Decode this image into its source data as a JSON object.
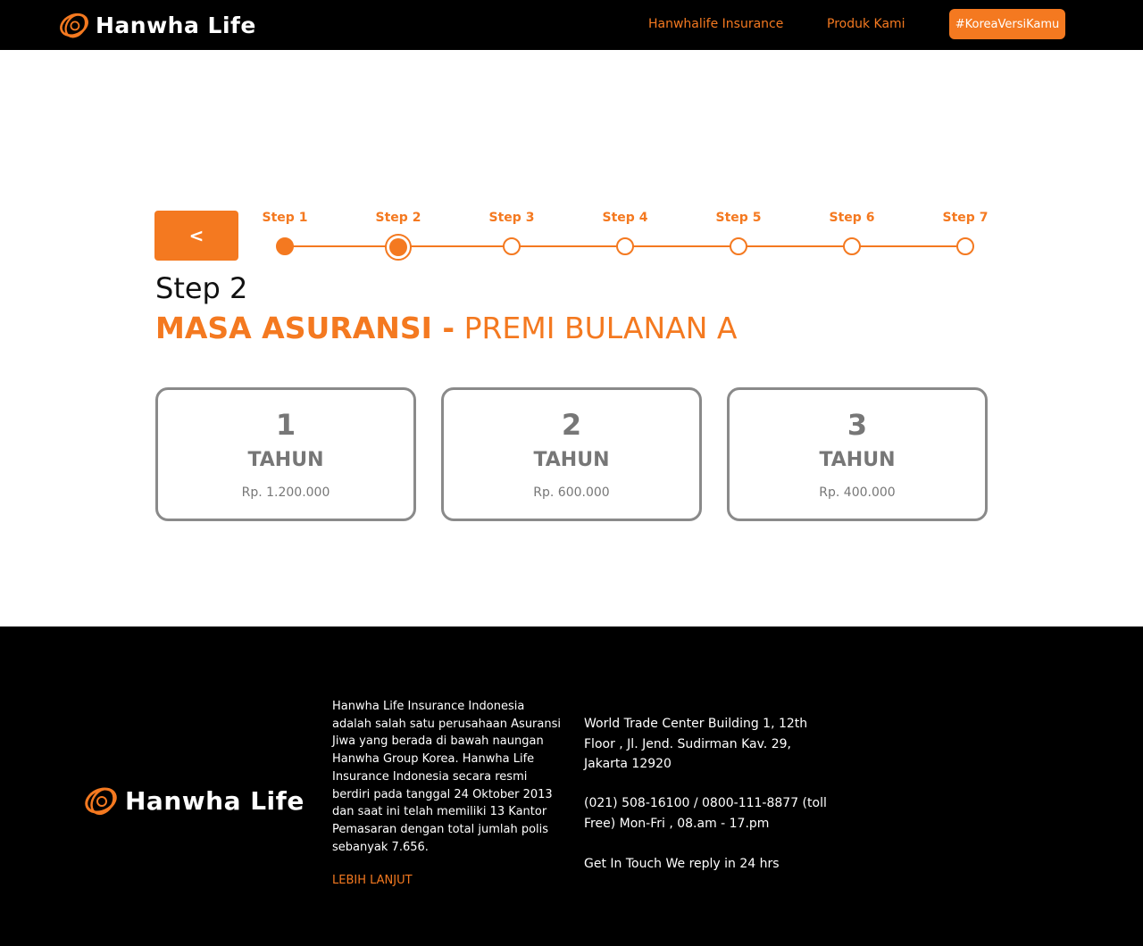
{
  "header": {
    "brand": "Hanwha Life",
    "nav": {
      "insurance": "Hanwhalife Insurance",
      "products": "Produk Kami",
      "cta": "#KoreaVersiKamu"
    }
  },
  "back_button": {
    "label": "<"
  },
  "stepper": {
    "steps": [
      "Step 1",
      "Step 2",
      "Step 3",
      "Step 4",
      "Step 5",
      "Step 6",
      "Step 7"
    ],
    "current": 2
  },
  "page": {
    "step_title": "Step 2",
    "section_title_bold": "MASA ASURANSI -",
    "section_title_rest": " PREMI BULANAN A"
  },
  "options": [
    {
      "number": "1",
      "unit": "TAHUN",
      "price": "Rp. 1.200.000"
    },
    {
      "number": "2",
      "unit": "TAHUN",
      "price": "Rp. 600.000"
    },
    {
      "number": "3",
      "unit": "TAHUN",
      "price": "Rp. 400.000"
    }
  ],
  "footer": {
    "brand": "Hanwha Life",
    "about": "Hanwha Life Insurance Indonesia adalah salah satu perusahaan Asuransi Jiwa yang berada di bawah naungan Hanwha Group Korea. Hanwha Life Insurance Indonesia secara resmi berdiri pada tanggal 24 Oktober 2013 dan saat ini telah memiliki 13 Kantor Pemasaran dengan total jumlah polis sebanyak 7.656.",
    "more_link": "LEBIH LANJUT",
    "address": "World Trade Center Building 1, 12th Floor , Jl. Jend. Sudirman Kav. 29, Jakarta 12920",
    "phone": "(021) 508-16100 / 0800-111-8877 (toll Free) Mon-Fri , 08.am - 17.pm",
    "get_in_touch": "Get In Touch We reply in 24 hrs"
  },
  "colors": {
    "accent": "#f47920",
    "dark": "#000000",
    "card_border": "#8a8a8a",
    "card_text": "#777777"
  },
  "icons": {
    "logo": "hanwha-swirl-logo-icon"
  }
}
